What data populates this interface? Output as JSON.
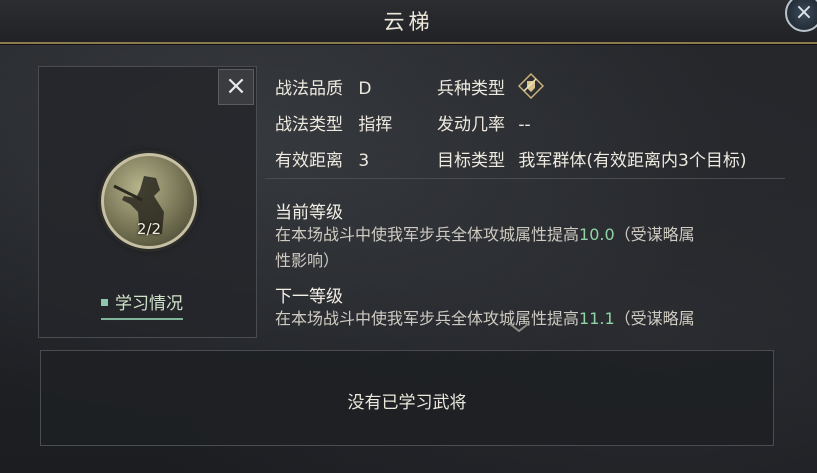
{
  "title": "云梯",
  "close_symbol": "×",
  "level_count": "2/2",
  "study_link_label": "学习情况",
  "info": {
    "quality_label": "战法品质",
    "quality_value": "D",
    "troop_label": "兵种类型",
    "type_label": "战法类型",
    "type_value": "指挥",
    "rate_label": "发动几率",
    "rate_value": "--",
    "range_label": "有效距离",
    "range_value": "3",
    "target_label": "目标类型",
    "target_value": "我军群体(有效距离内3个目标)"
  },
  "current": {
    "heading": "当前等级",
    "desc_prefix": "在本场战斗中使我军步兵全体攻城属性提高",
    "value": "10.0",
    "desc_suffix": "（受谋略属",
    "desc_line2": "性影响）"
  },
  "next": {
    "heading": "下一等级",
    "desc_prefix": "在本场战斗中使我军步兵全体攻城属性提高",
    "value": "11.1",
    "desc_suffix": "（受谋略属"
  },
  "empty_message": "没有已学习武将",
  "icons": {
    "close": "close-icon",
    "troop_type": "infantry-shield-icon",
    "scroll": "chevron-down-icon"
  },
  "colors": {
    "accent_gold": "#8c7a4e",
    "highlight_green": "#8fd3a6"
  }
}
